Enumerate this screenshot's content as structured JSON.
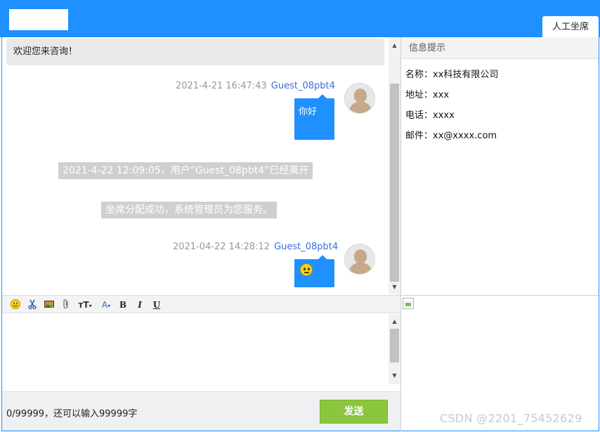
{
  "header": {
    "tab_label": "人工坐席"
  },
  "chat": {
    "welcome": "欢迎您来咨询！",
    "messages": [
      {
        "time": "2021-4-21 16:47:43",
        "sender": "Guest_08pbt4",
        "text": "你好"
      },
      {
        "time": "2021-04-22 14:28:12",
        "sender": "Guest_08pbt4",
        "content_icon": "smiley-emoji-icon"
      }
    ],
    "system_messages": [
      "2021-4-22 12:09:05，用户“Guest_08pbt4”已经离开",
      "坐席分配成功，系统管理员为您服务。"
    ]
  },
  "toolbar": {
    "items": [
      {
        "name": "emoji-icon"
      },
      {
        "name": "screenshot-scissors-icon"
      },
      {
        "name": "insert-image-icon"
      },
      {
        "name": "attachment-icon"
      },
      {
        "name": "font-size-icon",
        "label": "тT"
      },
      {
        "name": "font-color-icon",
        "label": "A"
      },
      {
        "name": "bold-icon",
        "label": "B"
      },
      {
        "name": "italic-icon",
        "label": "I"
      },
      {
        "name": "underline-icon",
        "label": "U"
      }
    ]
  },
  "footer": {
    "counter": "0/99999，还可以输入99999字",
    "send_label": "发送"
  },
  "info_panel": {
    "title": "信息提示",
    "lines": [
      "名称：xx科技有限公司",
      "地址：xxx",
      "电话：xxxx",
      "邮件：xx@xxxx.com"
    ]
  },
  "watermark": "CSDN @2201_75452629",
  "colors": {
    "accent": "#1e90ff",
    "send_button": "#8cc63f",
    "system_message_bg": "#cfcfcf"
  }
}
